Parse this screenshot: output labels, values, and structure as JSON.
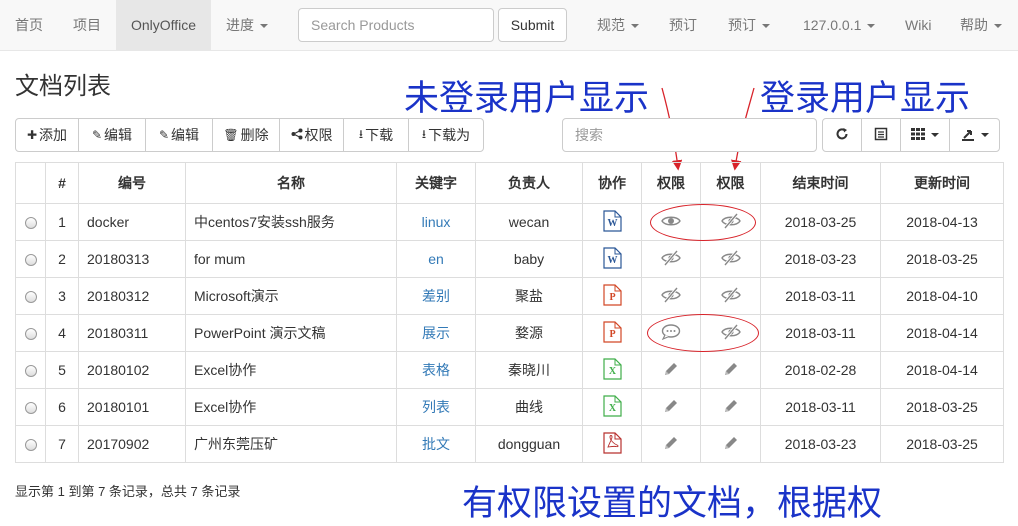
{
  "navbar": {
    "items": [
      {
        "label": "首页",
        "dropdown": false
      },
      {
        "label": "项目",
        "dropdown": false
      },
      {
        "label": "OnlyOffice",
        "dropdown": false,
        "active": true
      },
      {
        "label": "进度",
        "dropdown": true
      }
    ],
    "search_placeholder": "Search Products",
    "submit_label": "Submit",
    "right_items": [
      {
        "label": "规范",
        "dropdown": true
      },
      {
        "label": "预订",
        "dropdown": false
      },
      {
        "label": "预订",
        "dropdown": true
      },
      {
        "label": "127.0.0.1",
        "dropdown": true
      },
      {
        "label": "Wiki",
        "dropdown": false
      },
      {
        "label": "帮助",
        "dropdown": true
      }
    ]
  },
  "page": {
    "title": "文档列表"
  },
  "annotations": {
    "guest": "未登录用户显示",
    "logged_in": "登录用户显示",
    "bottom": "有权限设置的文档，根据权"
  },
  "toolbar": {
    "buttons": [
      {
        "icon": "plus-icon",
        "label": "添加"
      },
      {
        "icon": "edit-icon",
        "label": "编辑"
      },
      {
        "icon": "edit-icon",
        "label": "编辑"
      },
      {
        "icon": "trash-icon",
        "label": "删除"
      },
      {
        "icon": "share-icon",
        "label": "权限"
      },
      {
        "icon": "download-icon",
        "label": "下载"
      },
      {
        "icon": "download-icon",
        "label": "下载为"
      }
    ],
    "search_placeholder": "搜索",
    "tools": [
      "refresh-icon",
      "list-toggle-icon",
      "columns-icon",
      "export-icon"
    ]
  },
  "table": {
    "columns": [
      "",
      "#",
      "编号",
      "名称",
      "关键字",
      "负责人",
      "协作",
      "权限",
      "权限",
      "结束时间",
      "更新时间"
    ],
    "rows": [
      {
        "num": "1",
        "code": "docker",
        "name": "中centos7安装ssh服务",
        "keyword": "linux",
        "owner": "wecan",
        "type": "word",
        "perm1": "eye",
        "perm2": "eye-slash",
        "end": "2018-03-25",
        "updated": "2018-04-13"
      },
      {
        "num": "2",
        "code": "20180313",
        "name": "for mum",
        "keyword": "en",
        "owner": "baby",
        "type": "word",
        "perm1": "eye-slash",
        "perm2": "eye-slash",
        "end": "2018-03-23",
        "updated": "2018-03-25"
      },
      {
        "num": "3",
        "code": "20180312",
        "name": "Microsoft演示",
        "keyword": "差别",
        "owner": "聚盐",
        "type": "ppt",
        "perm1": "eye-slash",
        "perm2": "eye-slash",
        "end": "2018-03-11",
        "updated": "2018-04-10"
      },
      {
        "num": "4",
        "code": "20180311",
        "name": "PowerPoint 演示文稿",
        "keyword": "展示",
        "owner": "婺源",
        "type": "ppt",
        "perm1": "comment",
        "perm2": "eye-slash",
        "end": "2018-03-11",
        "updated": "2018-04-14"
      },
      {
        "num": "5",
        "code": "20180102",
        "name": "Excel协作",
        "keyword": "表格",
        "owner": "秦晓川",
        "type": "excel",
        "perm1": "pencil",
        "perm2": "pencil",
        "end": "2018-02-28",
        "updated": "2018-04-14"
      },
      {
        "num": "6",
        "code": "20180101",
        "name": "Excel协作",
        "keyword": "列表",
        "owner": "曲线",
        "type": "excel",
        "perm1": "pencil",
        "perm2": "pencil",
        "end": "2018-03-11",
        "updated": "2018-03-25"
      },
      {
        "num": "7",
        "code": "20170902",
        "name": "广州东莞压矿",
        "keyword": "批文",
        "owner": "dongguan",
        "type": "pdf",
        "perm1": "pencil",
        "perm2": "pencil",
        "end": "2018-03-23",
        "updated": "2018-03-25"
      }
    ]
  },
  "pagination_text": "显示第 1 到第 7 条记录，总共 7 条记录",
  "colors": {
    "annotation": "#1a33c8",
    "highlight": "#d8232a",
    "link": "#337ab7",
    "icon_gray": "#888888"
  }
}
